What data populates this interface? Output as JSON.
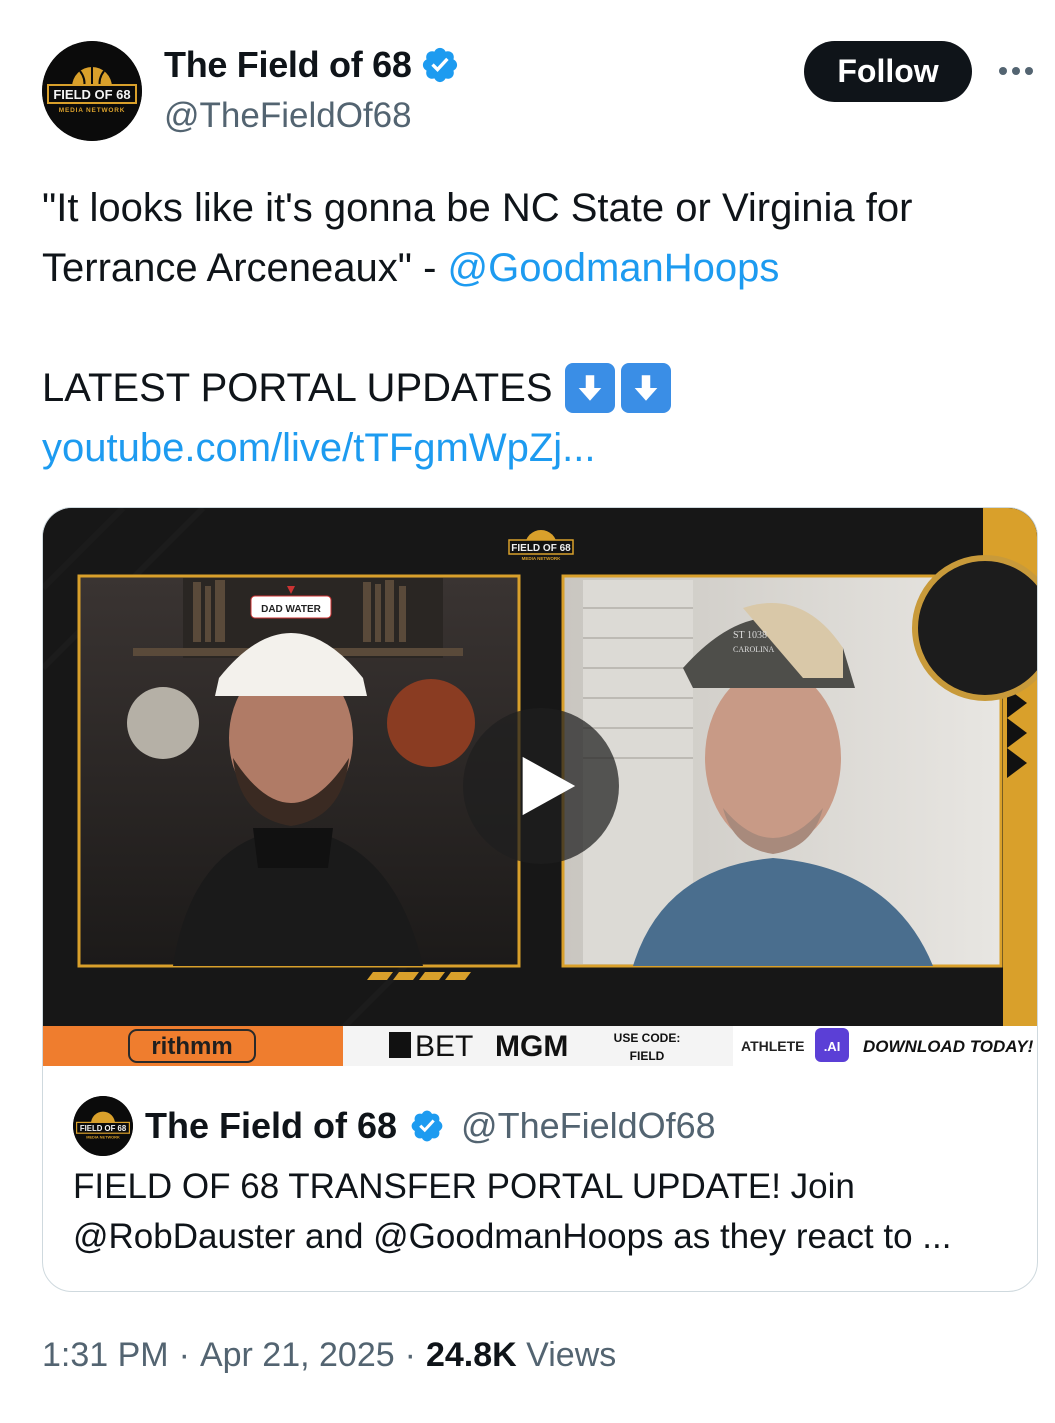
{
  "header": {
    "display_name": "The Field of 68",
    "handle": "@TheFieldOf68",
    "follow_label": "Follow",
    "more_icon": "ellipsis-icon",
    "avatar_text_main": "FIELD OF 68",
    "avatar_text_sub": "MEDIA NETWORK"
  },
  "tweet": {
    "text_line1": "\"It looks like it's gonna be NC State or Virginia for",
    "text_line2_prefix": "Terrance Arceneaux\" - ",
    "mention": "@GoodmanHoops",
    "latest": "LATEST PORTAL UPDATES",
    "link": "youtube.com/live/tTFgmWpZj..."
  },
  "video": {
    "logo_main": "FIELD OF 68",
    "logo_sub": "MEDIA NETWORK",
    "hat_left": "DAD WATER",
    "hat_right_1": "ST 1038",
    "hat_right_2": "CAROLINA",
    "sponsor_rithmm": "rithmm",
    "sponsor_bet": "BET",
    "sponsor_mgm": "MGM",
    "use_code_1": "USE CODE:",
    "use_code_2": "FIELD",
    "athlete": "ATHLETE",
    "athlete_ai": ".AI",
    "download": "DOWNLOAD TODAY!"
  },
  "quote": {
    "display_name": "The Field of 68",
    "handle": "@TheFieldOf68",
    "text_line1": "FIELD OF 68 TRANSFER PORTAL UPDATE! Join",
    "text_line2": "@RobDauster and @GoodmanHoops as they react to ..."
  },
  "meta": {
    "time": "1:31 PM",
    "sep1": "·",
    "date": "Apr 21, 2025",
    "sep2": "·",
    "views_count": "24.8K",
    "views_label": "Views"
  },
  "colors": {
    "link_blue": "#1d9bf0",
    "verified_blue": "#1d9bf0",
    "gold": "#d9a02b",
    "orange": "#ef7d2e"
  }
}
